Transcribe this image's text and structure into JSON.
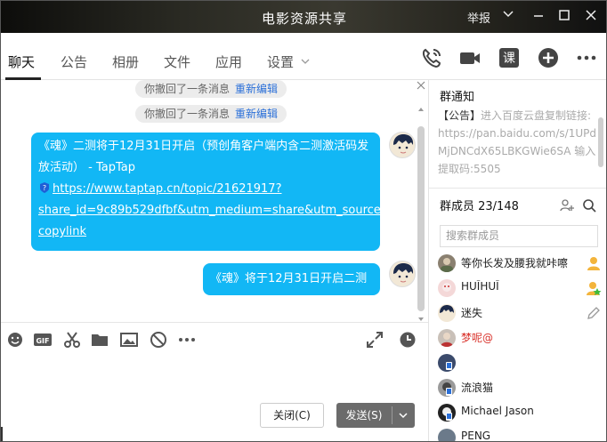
{
  "window": {
    "title": "电影资源共享",
    "report_label": "举报"
  },
  "tabs": [
    "聊天",
    "公告",
    "相册",
    "文件",
    "应用",
    "设置"
  ],
  "messages": {
    "system": [
      {
        "text": "你撤回了一条消息",
        "link": "重新编辑"
      },
      {
        "text": "你撤回了一条消息",
        "link": "重新编辑"
      }
    ],
    "bubble1": {
      "line1": "《魂》二测将于12月31日开启（预创角客户端内含二测激活码发",
      "line2": "放活动） - TapTap",
      "link1": "https://www.taptap.cn/topic/21621917?",
      "link2": "share_id=9c89b529dfbf&utm_medium=share&utm_source=",
      "link3": "copylink"
    },
    "bubble2": "《魂》将于12月31日开启二测"
  },
  "composer": {
    "close_label": "关闭(C)",
    "send_label": "发送(S)"
  },
  "sidebar": {
    "notice_title": "群通知",
    "notice_tag": "【公告】",
    "notice_text": "进入百度云盘复制链接: https://pan.baidu.com/s/1UPdMjDNCdX65LBKGWie6SA 输入提取码:5505",
    "members_title": "群成员 23/148",
    "search_placeholder": "搜索群成员",
    "members": [
      {
        "name": "等你长发及腰我就咔嚓",
        "badge": "owner"
      },
      {
        "name": "HUĪHUĪ",
        "badge": "admin"
      },
      {
        "name": "迷失",
        "badge": "edit"
      },
      {
        "name": "梦呢@",
        "badge": "",
        "color": "#d9322b"
      },
      {
        "name": "",
        "badge": ""
      },
      {
        "name": "流浪猫",
        "badge": ""
      },
      {
        "name": "Michael Jason",
        "badge": ""
      },
      {
        "name": "PENG",
        "badge": ""
      }
    ]
  },
  "colors": {
    "bubble": "#12b7f5",
    "link": "#2a6fd8",
    "send_button": "#6b6b6b"
  }
}
